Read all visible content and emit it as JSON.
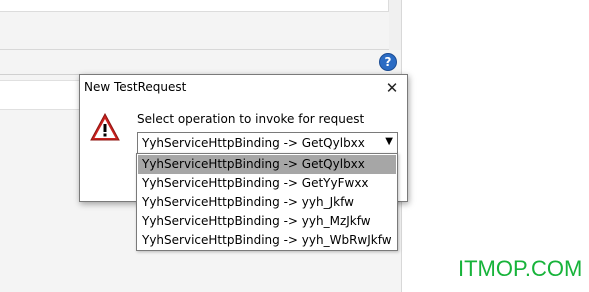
{
  "background": {
    "help_icon_glyph": "?"
  },
  "dialog": {
    "title": "New TestRequest",
    "close_glyph": "✕",
    "prompt": "Select operation to invoke for request",
    "selected_value": "YyhServiceHttpBinding -> GetQylbxx",
    "arrow_glyph": "▼"
  },
  "dropdown": {
    "options": [
      "YyhServiceHttpBinding -> GetQylbxx",
      "YyhServiceHttpBinding -> GetYyFwxx",
      "YyhServiceHttpBinding -> yyh_Jkfw",
      "YyhServiceHttpBinding -> yyh_MzJkfw",
      "YyhServiceHttpBinding -> yyh_WbRwJkfw"
    ],
    "selected_index": 0
  },
  "watermark": {
    "text": "ITMOP.COM",
    "color": "#17b33a"
  },
  "colors": {
    "highlight": "#a6a6a6",
    "warning_red": "#c9211e",
    "help_blue": "#2b6cc4"
  }
}
